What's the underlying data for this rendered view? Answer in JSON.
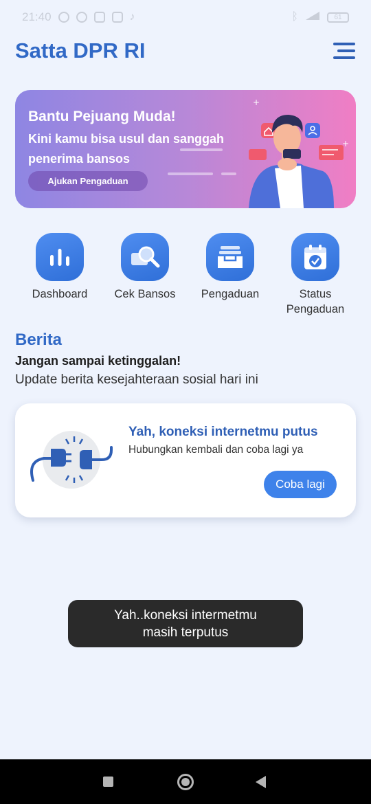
{
  "status_bar": {
    "time": "21:40",
    "battery": "61"
  },
  "header": {
    "title": "Satta DPR RI",
    "menu_icon": "hamburger-menu-icon"
  },
  "banner": {
    "title": "Bantu Pejuang Muda!",
    "subtitle": "Kini kamu bisa usul dan sanggah penerima  bansos",
    "button_label": "Ajukan Pengaduan",
    "gradient": [
      "#8e86e3",
      "#f07ec4"
    ]
  },
  "quick_menu": [
    {
      "label": "Dashboard",
      "icon": "bar-chart-icon"
    },
    {
      "label": "Cek Bansos",
      "icon": "magnifier-icon"
    },
    {
      "label": "Pengaduan",
      "icon": "inbox-tray-icon"
    },
    {
      "label": "Status Pengaduan",
      "icon": "calendar-check-icon"
    }
  ],
  "news": {
    "title": "Berita",
    "headline": "Jangan sampai ketinggalan!",
    "subtitle": "Update berita kesejahteraan sosial hari ini"
  },
  "error_card": {
    "title": "Yah, koneksi internetmu putus",
    "message": "Hubungkan kembali dan coba lagi ya",
    "retry_label": "Coba lagi",
    "icon": "unplugged-cable-icon"
  },
  "toast": {
    "line1": "Yah..koneksi intermetmu",
    "line2": "masih terputus"
  },
  "colors": {
    "brand": "#3169c6",
    "background": "#eef3fd",
    "button": "#3e82ea"
  }
}
